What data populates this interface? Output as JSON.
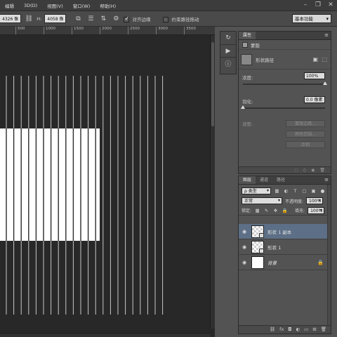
{
  "menubar": {
    "items": [
      "编辑",
      "3D(D)",
      "视图(V)",
      "窗口(W)",
      "帮助(H)"
    ]
  },
  "options": {
    "w_value": "4326 像",
    "h_label": "H:",
    "h_value": "4058 像",
    "align_edges_label": "对齐边缘",
    "align_edges_checked": true,
    "constrain_label": "约束路径拖动",
    "constrain_checked": false,
    "workspace_label": "基本功能"
  },
  "ruler": {
    "ticks": [
      "500",
      "1000",
      "1500",
      "2000",
      "2500",
      "3000",
      "3500"
    ]
  },
  "toolstrip": {
    "icons": [
      "history-icon",
      "play-icon",
      "info-icon"
    ]
  },
  "properties": {
    "tab_label": "属性",
    "mask_label": "蒙版",
    "shape_label": "形状路径",
    "density_label": "浓度:",
    "density_value": "100%",
    "density_fraction": 1.0,
    "feather_label": "羽化:",
    "feather_value": "0.0 像素",
    "feather_fraction": 0.0,
    "adjust_label": "调整:",
    "mask_edge_button": "蒙版边缘...",
    "color_range_button": "颜色范围...",
    "invert_button": "反相"
  },
  "layers": {
    "tabs": [
      "图层",
      "通道",
      "路径"
    ],
    "filter_label": "ρ 类型",
    "blend_mode": "正常",
    "opacity_label": "不透明度:",
    "opacity_value": "100%",
    "lock_label": "锁定:",
    "fill_label": "填充:",
    "fill_value": "100%",
    "items": [
      {
        "name": "形状 1 副本",
        "active": true,
        "thumb": "checker"
      },
      {
        "name": "形状 1",
        "active": false,
        "thumb": "checker"
      },
      {
        "name": "背景",
        "active": false,
        "thumb": "white"
      }
    ],
    "footer_icons": [
      "link-icon",
      "fx-icon",
      "mask-icon",
      "adjustment-icon",
      "group-icon",
      "new-layer-icon",
      "trash-icon"
    ]
  },
  "colors": {
    "canvas_bg": "#282828",
    "doc_white": "#ffffff",
    "stripe_dark": "#2b2b2b",
    "stripe_line": "#c8c8c8",
    "active_layer": "#5c6f86"
  }
}
